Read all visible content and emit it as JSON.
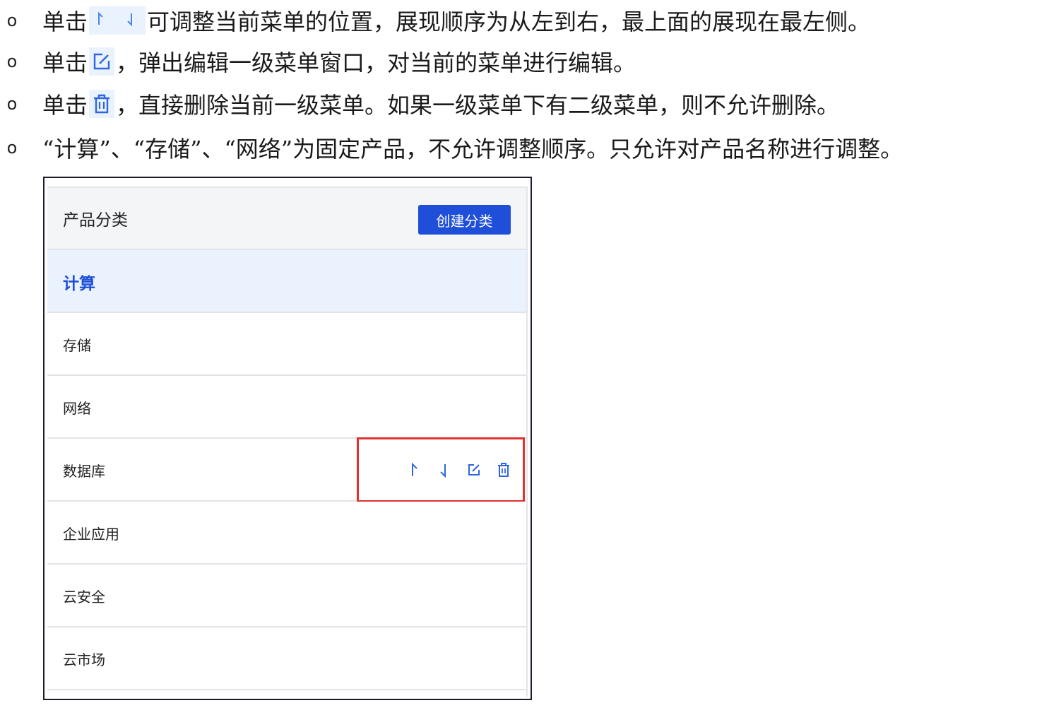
{
  "bullets": [
    {
      "marker": "o",
      "prefix": "单击",
      "icon": "up-down-arrows-icon",
      "suffix": "可调整当前菜单的位置，展现顺序为从左到右，最上面的展现在最左侧。"
    },
    {
      "marker": "o",
      "prefix": "单击",
      "icon": "edit-icon",
      "suffix": "，弹出编辑一级菜单窗口，对当前的菜单进行编辑。"
    },
    {
      "marker": "o",
      "prefix": "单击",
      "icon": "trash-icon",
      "suffix": "，直接删除当前一级菜单。如果一级菜单下有二级菜单，则不允许删除。"
    },
    {
      "marker": "o",
      "text": "“计算”、“存储”、“网络”为固定产品，不允许调整顺序。只允许对产品名称进行调整。"
    }
  ],
  "panel": {
    "title": "产品分类",
    "create_button": "创建分类",
    "categories": [
      "计算",
      "存储",
      "网络",
      "数据库",
      "企业应用",
      "云安全",
      "云市场"
    ],
    "active_index": 0,
    "highlight_row_index": 3,
    "row_actions": [
      "move-up-icon",
      "move-down-icon",
      "edit-icon",
      "trash-icon"
    ]
  },
  "colors": {
    "accent_blue": "#1f4fd9",
    "active_row_bg": "#eaf2fd",
    "highlight_red": "#e0322f",
    "header_bg": "#f4f5f7"
  }
}
